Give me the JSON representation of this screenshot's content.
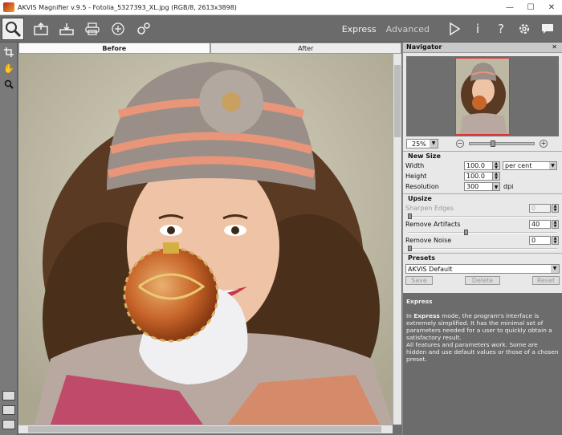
{
  "window": {
    "title": "AKVIS Magnifier v.9.5 - Fotolia_5327393_XL.jpg (RGB/8, 2613x3898)",
    "minimize": "—",
    "maximize": "☐",
    "close": "✕"
  },
  "toolbar": {
    "mode_express": "Express",
    "mode_advanced": "Advanced",
    "icons": [
      "open-icon",
      "save-icon",
      "print-icon",
      "share-icon",
      "preferences-icon",
      "run-icon",
      "info-icon",
      "help-icon",
      "settings-icon",
      "comment-icon"
    ]
  },
  "view_tabs": {
    "before": "Before",
    "after": "After"
  },
  "navigator": {
    "title": "Navigator",
    "close": "✕",
    "zoom": "25%",
    "minus": "−",
    "plus": "+"
  },
  "new_size": {
    "title": "New Size",
    "width_label": "Width",
    "width_value": "100.0",
    "height_label": "Height",
    "height_value": "100.0",
    "units": "per cent",
    "resolution_label": "Resolution",
    "resolution_value": "300",
    "resolution_unit": "dpi"
  },
  "upsize": {
    "title": "Upsize",
    "sharpen_label": "Sharpen Edges",
    "sharpen_value": "0",
    "artifacts_label": "Remove Artifacts",
    "artifacts_value": "40",
    "noise_label": "Remove Noise",
    "noise_value": "0"
  },
  "presets": {
    "title": "Presets",
    "selected": "AKVIS Default",
    "save": "Save",
    "delete": "Delete",
    "reset": "Reset"
  },
  "help": {
    "title": "Express",
    "p1_prefix": "In ",
    "p1_bold": "Express",
    "p1_rest": " mode, the program's interface is extremely simplified. It has the minimal set of parameters needed for a user to quickly obtain a satisfactory result.",
    "p2": "All features and parameters work. Some are hidden and use default values or those of a chosen preset."
  },
  "colors": {
    "toolbar_bg": "#6b6b6b",
    "panel_bg": "#e8e8e8",
    "help_bg": "#6c6c6c"
  }
}
